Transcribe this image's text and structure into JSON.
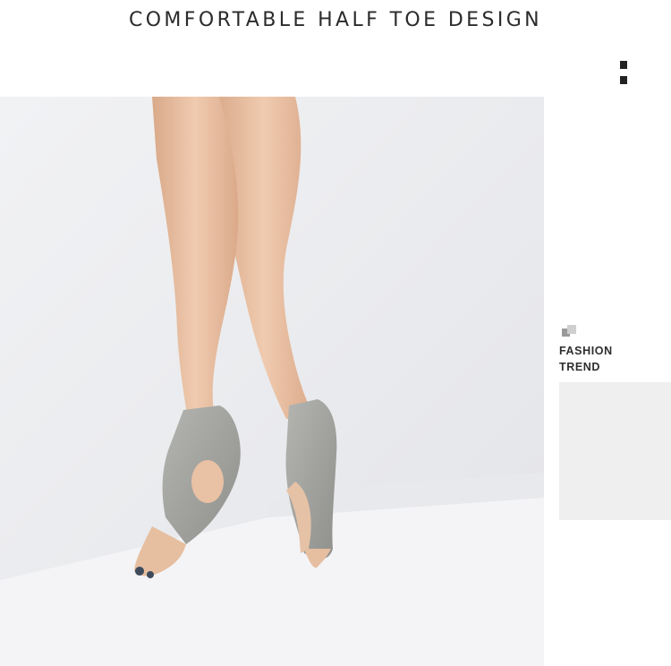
{
  "header": {
    "title": "COMFORTABLE HALF TOE DESIGN"
  },
  "side_panel": {
    "label_line1": "FASHION",
    "label_line2": "TREND"
  },
  "photo": {
    "subject": "legs-wearing-grey-half-toe-yoga-socks"
  },
  "colors": {
    "background": "#ffffff",
    "photo_backdrop": "#ecedf0",
    "sock_grey": "#a9aaa6",
    "skin": "#e8c0a2",
    "swatch": "#efefef",
    "text": "#2b2b2b"
  }
}
